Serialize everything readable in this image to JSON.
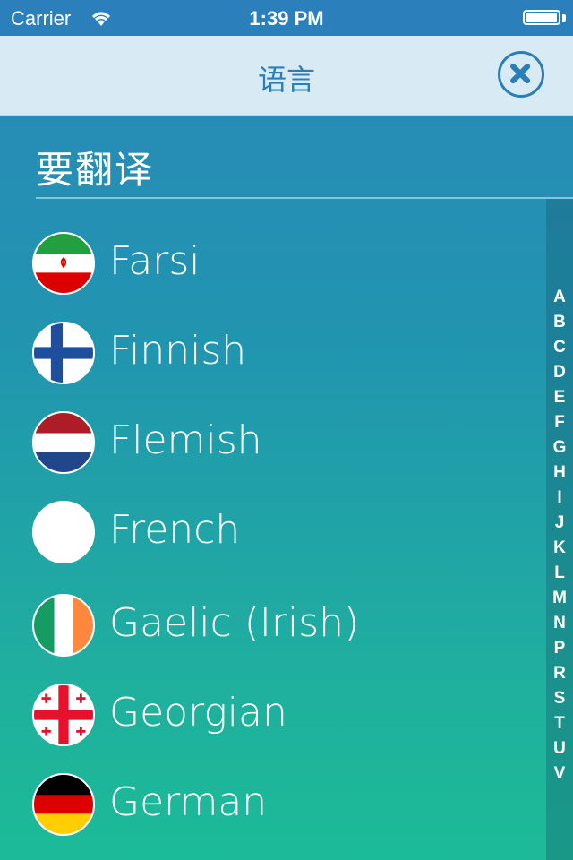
{
  "status_bar": {
    "carrier": "Carrier",
    "time": "1:39 PM"
  },
  "nav": {
    "title": "语言",
    "close_icon": "close-icon"
  },
  "section": {
    "title": "要翻译"
  },
  "languages": [
    {
      "label": "Farsi",
      "flag": "iran-flag"
    },
    {
      "label": "Finnish",
      "flag": "finland-flag"
    },
    {
      "label": "Flemish",
      "flag": "netherlands-flag"
    },
    {
      "label": "French",
      "flag": "blank-flag"
    },
    {
      "label": "Gaelic (Irish)",
      "flag": "ireland-flag"
    },
    {
      "label": "Georgian",
      "flag": "georgia-flag"
    },
    {
      "label": "German",
      "flag": "germany-flag"
    }
  ],
  "index": [
    "A",
    "B",
    "C",
    "D",
    "E",
    "F",
    "G",
    "H",
    "I",
    "J",
    "K",
    "L",
    "M",
    "N",
    "P",
    "R",
    "S",
    "T",
    "U",
    "V"
  ],
  "colors": {
    "status_bar": "#2b80bb",
    "nav_bar": "#d8ebf5",
    "accent": "#2b7fb6",
    "gradient_top": "#2a88b8",
    "gradient_bottom": "#1cbb97"
  }
}
